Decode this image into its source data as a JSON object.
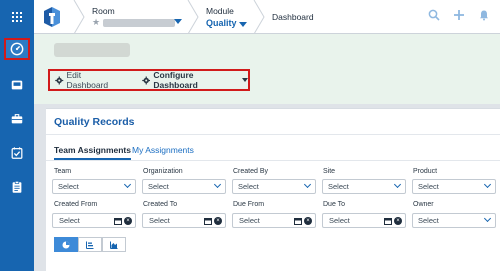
{
  "header": {
    "room_label": "Room",
    "module_label": "Module",
    "module_value": "Quality",
    "page_crumb": "Dashboard",
    "icons": [
      "search-icon",
      "plus-icon",
      "bell-icon"
    ]
  },
  "rail": {
    "items": [
      "apps-grid-icon",
      "dashboard-gauge-icon",
      "inbox-icon",
      "briefcase-icon",
      "tasks-check-icon",
      "forms-clipboard-icon"
    ],
    "active": "dashboard-gauge-icon"
  },
  "dashboard": {
    "edit_label": "Edit Dashboard",
    "configure_label": "Configure Dashboard"
  },
  "quality": {
    "title": "Quality Records",
    "tabs": [
      "Team Assignments",
      "My Assignments"
    ],
    "active_tab": "Team Assignments",
    "row1": [
      {
        "label": "Team",
        "value": "Select"
      },
      {
        "label": "Organization",
        "value": "Select"
      },
      {
        "label": "Created By",
        "value": "Select"
      },
      {
        "label": "Site",
        "value": "Select"
      },
      {
        "label": "Product",
        "value": "Select"
      }
    ],
    "row2": [
      {
        "label": "Created From",
        "value": "Select"
      },
      {
        "label": "Created To",
        "value": "Select"
      },
      {
        "label": "Due From",
        "value": "Select"
      },
      {
        "label": "Due To",
        "value": "Select"
      },
      {
        "label": "Owner",
        "value": "Select"
      }
    ],
    "view_options": [
      "pie-chart-icon",
      "bar-chart-icon",
      "area-chart-icon"
    ],
    "active_view": "pie-chart-icon"
  },
  "colors": {
    "primary": "#1765b0",
    "highlight": "#d11a1a",
    "band": "#e9f3ec"
  }
}
